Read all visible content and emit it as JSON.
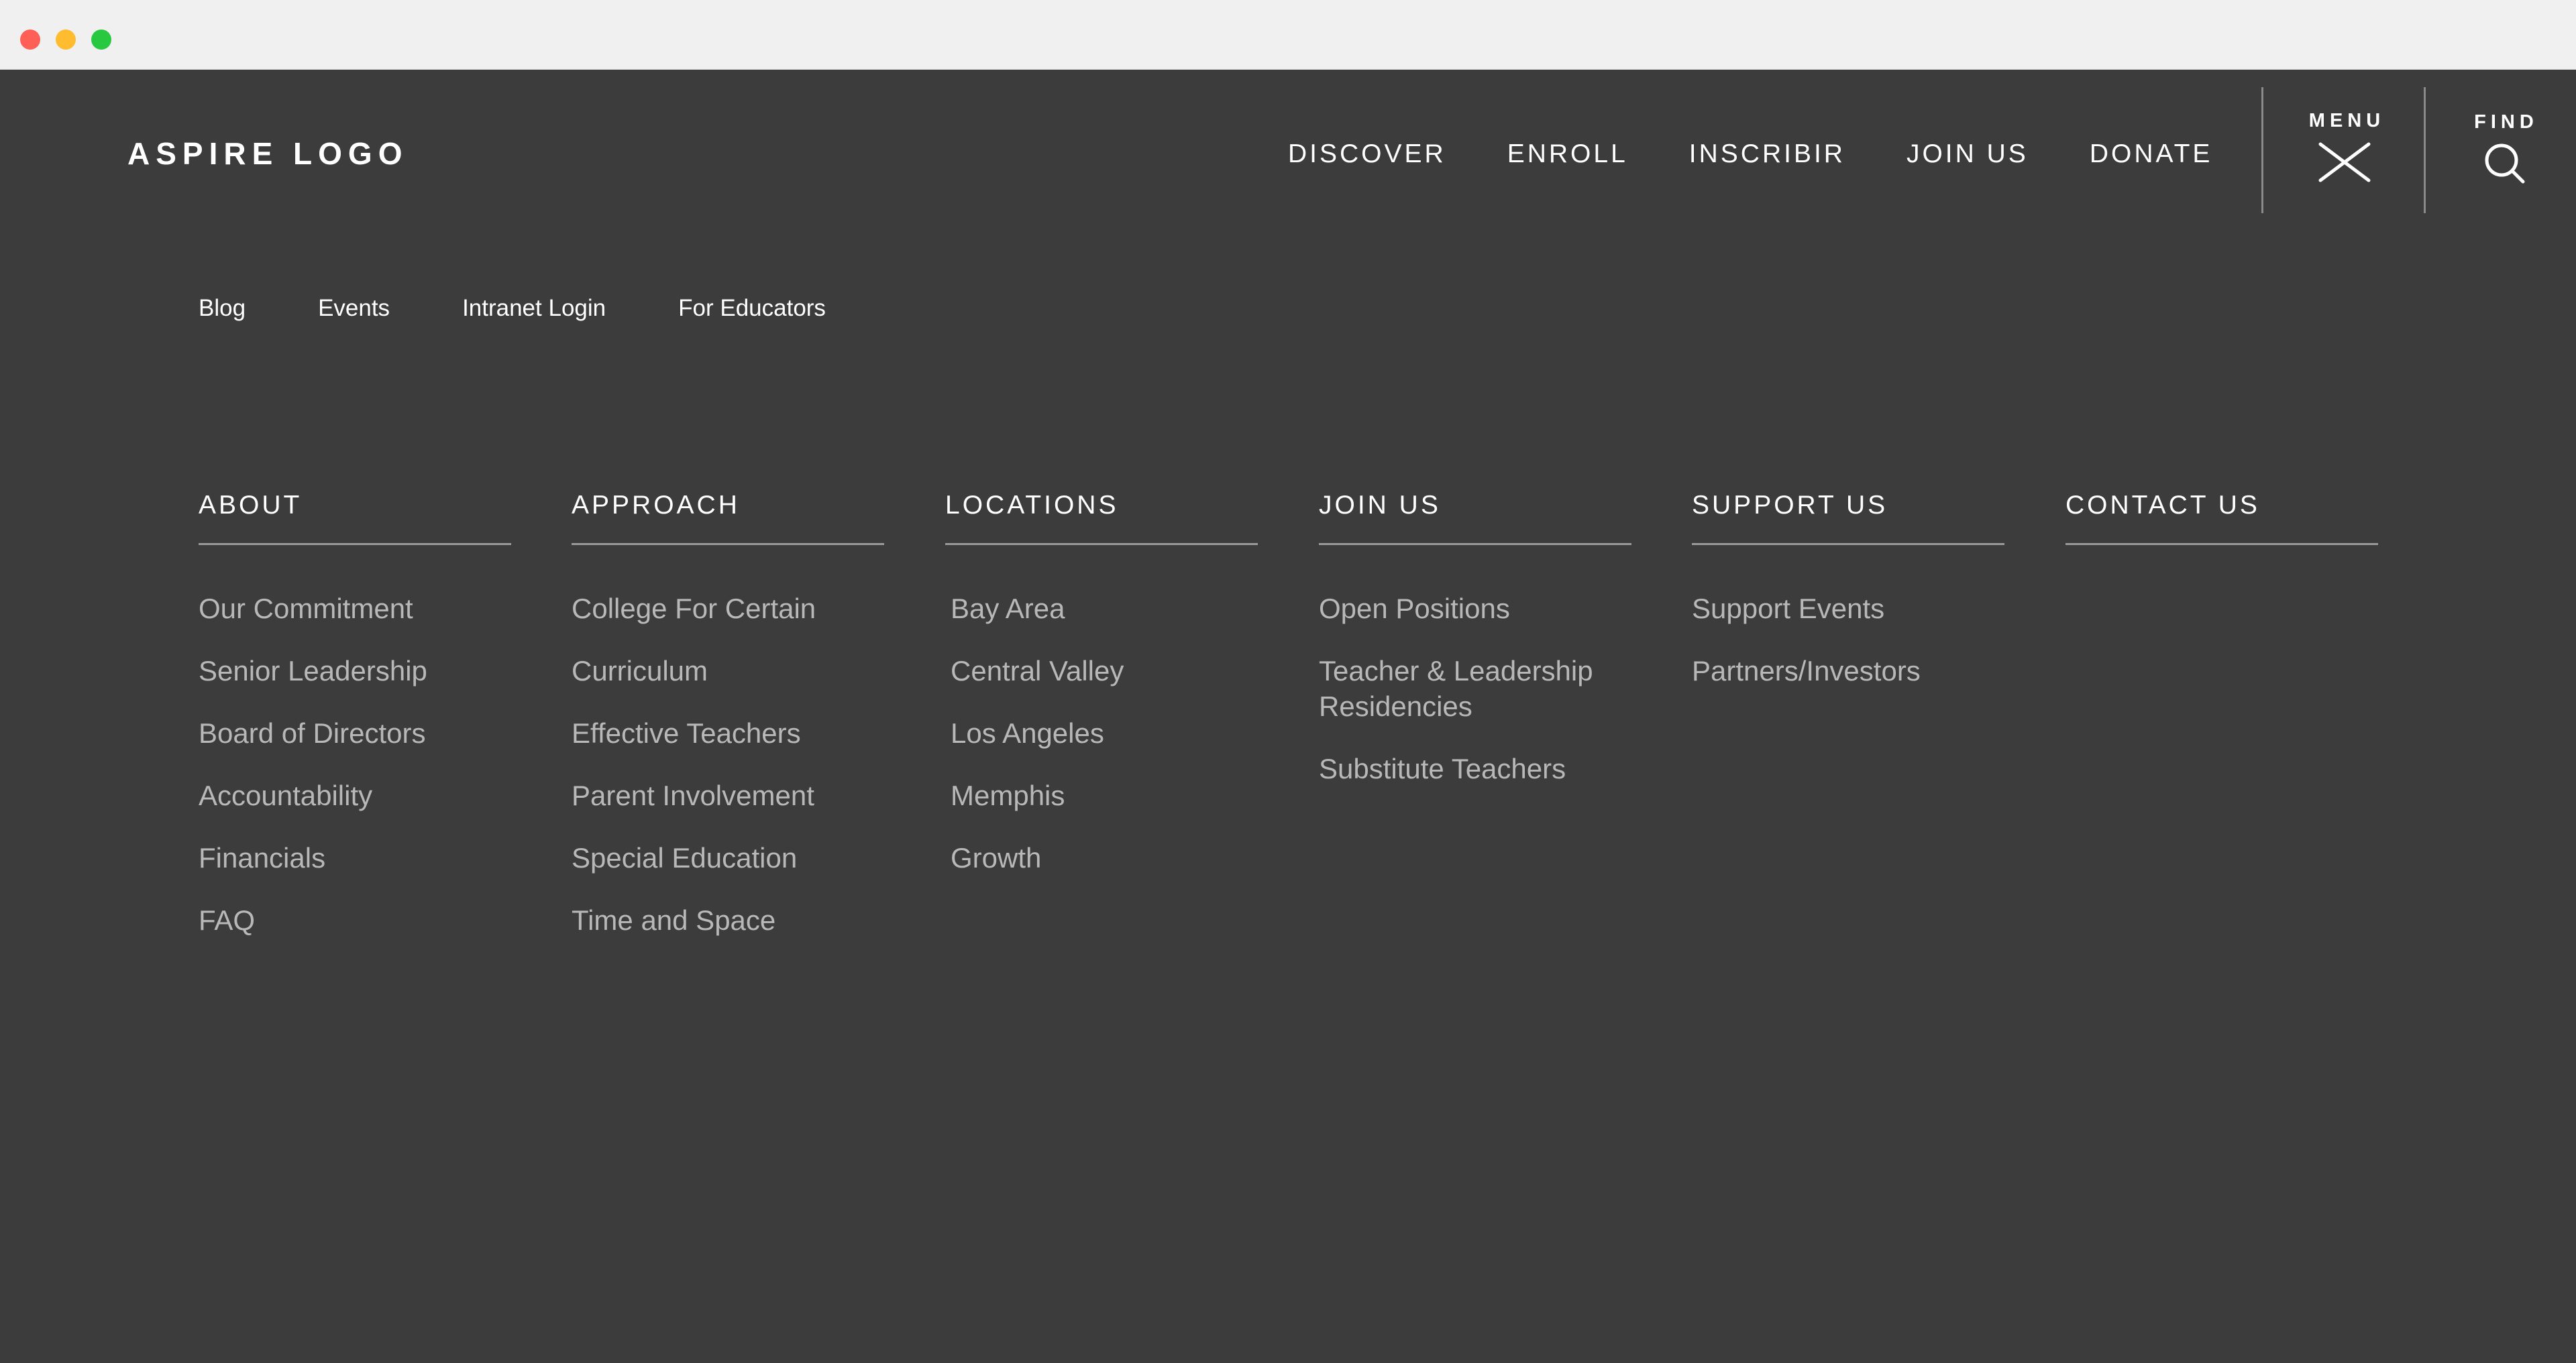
{
  "logo": "ASPIRE LOGO",
  "top_nav": [
    "DISCOVER",
    "ENROLL",
    "INSCRIBIR",
    "JOIN US",
    "DONATE"
  ],
  "menu": {
    "label": "MENU",
    "icon": "close-icon"
  },
  "find": {
    "label": "FIND",
    "icon": "search-icon"
  },
  "utility_nav": [
    "Blog",
    "Events",
    "Intranet Login",
    "For Educators"
  ],
  "columns": [
    {
      "heading": "ABOUT",
      "items": [
        "Our Commitment",
        "Senior Leadership",
        "Board of Directors",
        "Accountability",
        "Financials",
        "FAQ"
      ]
    },
    {
      "heading": "APPROACH",
      "items": [
        "College For Certain",
        "Curriculum",
        "Effective Teachers",
        "Parent Involvement",
        "Special Education",
        "Time and Space"
      ]
    },
    {
      "heading": "LOCATIONS",
      "items": [
        "Bay Area",
        "Central Valley",
        "Los Angeles",
        "Memphis",
        "Growth"
      ]
    },
    {
      "heading": "JOIN US",
      "items": [
        "Open Positions",
        "Teacher & Leadership Residencies",
        "Substitute Teachers"
      ]
    },
    {
      "heading": "SUPPORT US",
      "items": [
        "Support Events",
        "Partners/Investors"
      ]
    },
    {
      "heading": "CONTACT US",
      "items": []
    }
  ],
  "colors": {
    "background": "#3c3c3c",
    "text_primary": "#ffffff",
    "text_secondary": "#b8b8b8",
    "divider": "#9a9a9a",
    "window_close": "#fe5f57",
    "window_minimize": "#febc2e",
    "window_zoom": "#28c840"
  }
}
